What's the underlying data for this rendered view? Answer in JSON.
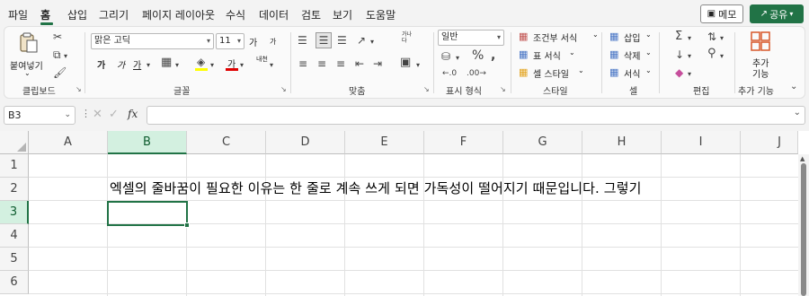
{
  "menu": {
    "tabs": [
      "파일",
      "홈",
      "삽입",
      "그리기",
      "페이지 레이아웃",
      "수식",
      "데이터",
      "검토",
      "보기",
      "도움말"
    ],
    "active": "홈",
    "memo_label": "메모",
    "share_label": "공유"
  },
  "ribbon": {
    "clipboard": {
      "paste_label": "붙여넣기",
      "group_label": "클립보드"
    },
    "font": {
      "font_name": "맑은 고딕",
      "font_size": "11",
      "group_label": "글꼴",
      "bold": "가",
      "italic": "가",
      "underline": "가",
      "grow": "가",
      "shrink": "가",
      "font_color": "가",
      "phonetic": "내천"
    },
    "alignment": {
      "group_label": "맞춤",
      "wrap_label": "가나다"
    },
    "number": {
      "format": "일반",
      "group_label": "표시 형식"
    },
    "styles": {
      "conditional": "조건부 서식",
      "table": "표 서식",
      "cell": "셀 스타일",
      "group_label": "스타일"
    },
    "cells": {
      "insert": "삽입",
      "delete": "삭제",
      "format": "서식",
      "group_label": "셀"
    },
    "editing": {
      "group_label": "편집"
    },
    "addins": {
      "button": "추가\n기능",
      "btn_line1": "추가",
      "btn_line2": "기능",
      "group_label": "추가 기능"
    }
  },
  "formula_bar": {
    "name_box": "B3",
    "fx": "fx",
    "content": ""
  },
  "sheet": {
    "columns": [
      "A",
      "B",
      "C",
      "D",
      "E",
      "F",
      "G",
      "H",
      "I",
      "J"
    ],
    "selected_column": "B",
    "rows": [
      "1",
      "2",
      "3",
      "4",
      "5",
      "6"
    ],
    "selected_row": "3",
    "b2_text": "엑셀의 줄바꿈이 필요한 이유는 한 줄로 계속 쓰게 되면 가독성이 떨어지기 때문입니다. 그렇기"
  },
  "colors": {
    "accent": "#217346",
    "selected_header_bg": "#d3f0e0"
  }
}
